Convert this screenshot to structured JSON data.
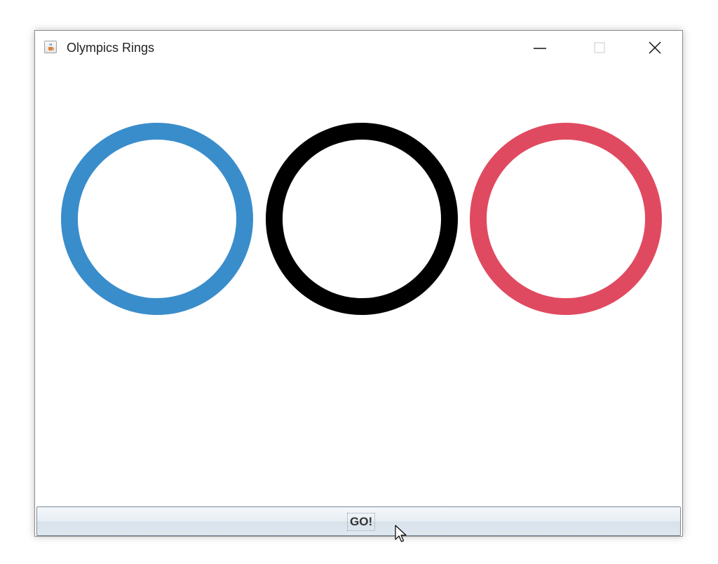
{
  "window": {
    "title": "Olympics Rings",
    "icon": "java-cup-icon",
    "controls": [
      "minimize-icon",
      "maximize-icon",
      "close-icon"
    ]
  },
  "rings": [
    {
      "name": "blue-ring",
      "color": "#3a8dcb"
    },
    {
      "name": "black-ring",
      "color": "#000000"
    },
    {
      "name": "red-ring",
      "color": "#e04a60"
    }
  ],
  "go_button": {
    "label": "GO!"
  },
  "cursor": "arrow-cursor-icon"
}
